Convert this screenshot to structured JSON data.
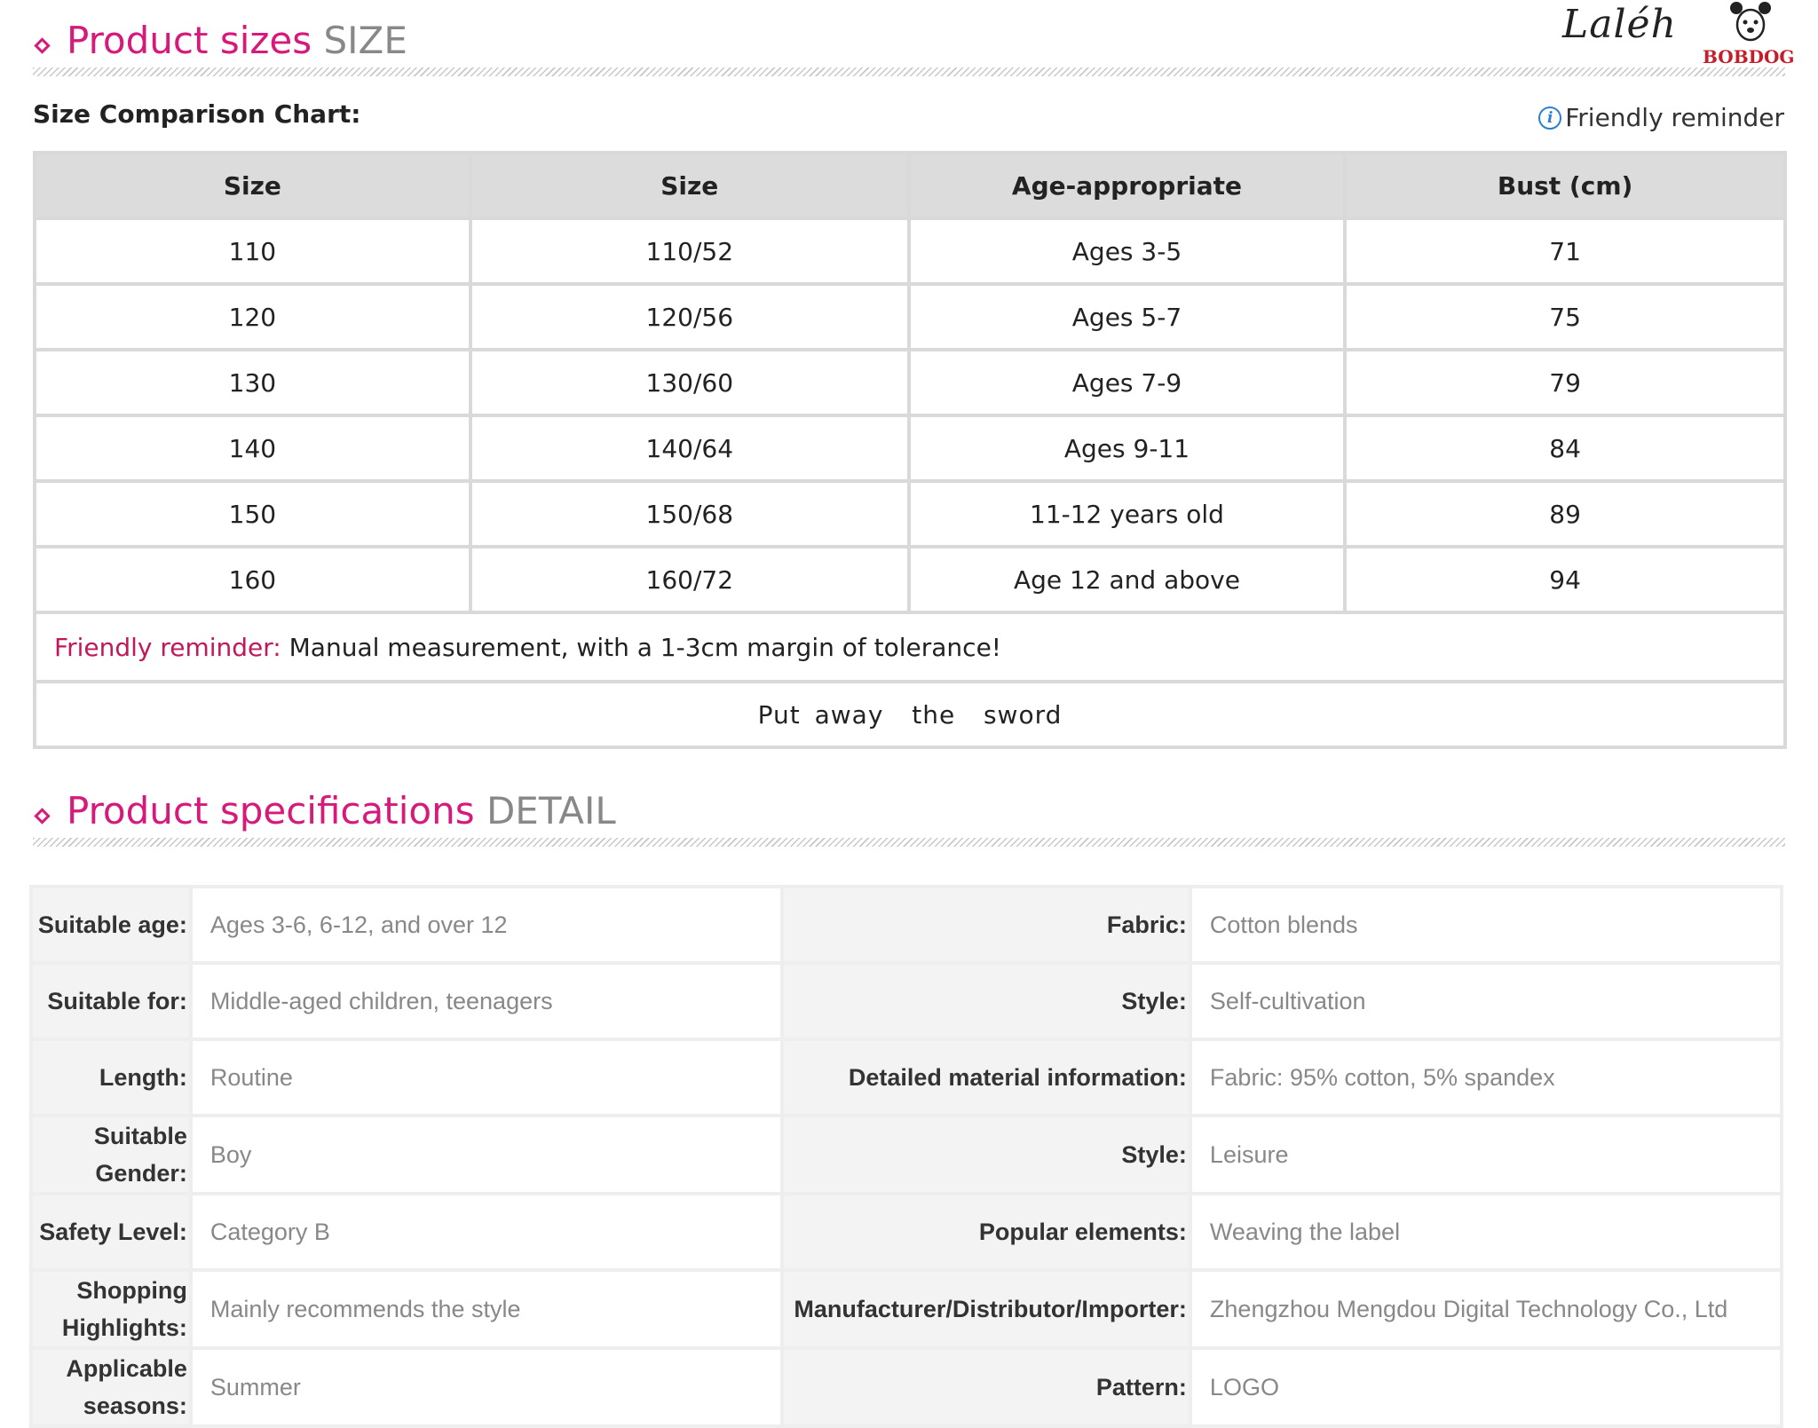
{
  "size_section": {
    "title_main": "Product sizes",
    "title_suffix": "SIZE"
  },
  "logo": {
    "script_text": "Laléh",
    "brand_text": "BOBDOG"
  },
  "chart": {
    "label": "Size Comparison Chart:",
    "reminder_link": "Friendly reminder",
    "headers": [
      "Size",
      "Size",
      "Age-appropriate",
      "Bust (cm)"
    ],
    "rows": [
      [
        "110",
        "110/52",
        "Ages 3-5",
        "71"
      ],
      [
        "120",
        "120/56",
        "Ages 5-7",
        "75"
      ],
      [
        "130",
        "130/60",
        "Ages 7-9",
        "79"
      ],
      [
        "140",
        "140/64",
        "Ages 9-11",
        "84"
      ],
      [
        "150",
        "150/68",
        "11-12 years old",
        "89"
      ],
      [
        "160",
        "160/72",
        "Age 12 and above",
        "94"
      ]
    ],
    "reminder_label": "Friendly reminder:",
    "reminder_text": "Manual measurement, with a 1-3cm margin of tolerance!",
    "footer": "Put away  the  sword"
  },
  "detail_section": {
    "title_main": "Product specifications",
    "title_suffix": "DETAIL"
  },
  "specs": [
    {
      "k1": "Suitable age:",
      "v1": "Ages 3-6, 6-12, and over 12",
      "k2": "Fabric:",
      "v2": "Cotton blends"
    },
    {
      "k1": "Suitable for:",
      "v1": "Middle-aged children, teenagers",
      "k2": "Style:",
      "v2": "Self-cultivation"
    },
    {
      "k1": "Length:",
      "v1": "Routine",
      "k2": "Detailed material information:",
      "v2": "Fabric: 95% cotton, 5% spandex"
    },
    {
      "k1": "Suitable Gender:",
      "v1": "Boy",
      "k2": "Style:",
      "v2": "Leisure"
    },
    {
      "k1": "Safety Level:",
      "v1": "Category B",
      "k2": "Popular elements:",
      "v2": "Weaving the label"
    },
    {
      "k1": "Shopping Highlights:",
      "v1": "Mainly recommends the style",
      "k2": "Manufacturer/Distributor/Importer:",
      "v2": "Zhengzhou Mengdou Digital Technology Co., Ltd"
    },
    {
      "k1": "Applicable seasons:",
      "v1": "Summer",
      "k2": "Pattern:",
      "v2": "LOGO"
    }
  ],
  "colors": {
    "accent_pink": "#d6197a",
    "info_blue": "#2a7fd4",
    "brand_red": "#c41e2a"
  }
}
